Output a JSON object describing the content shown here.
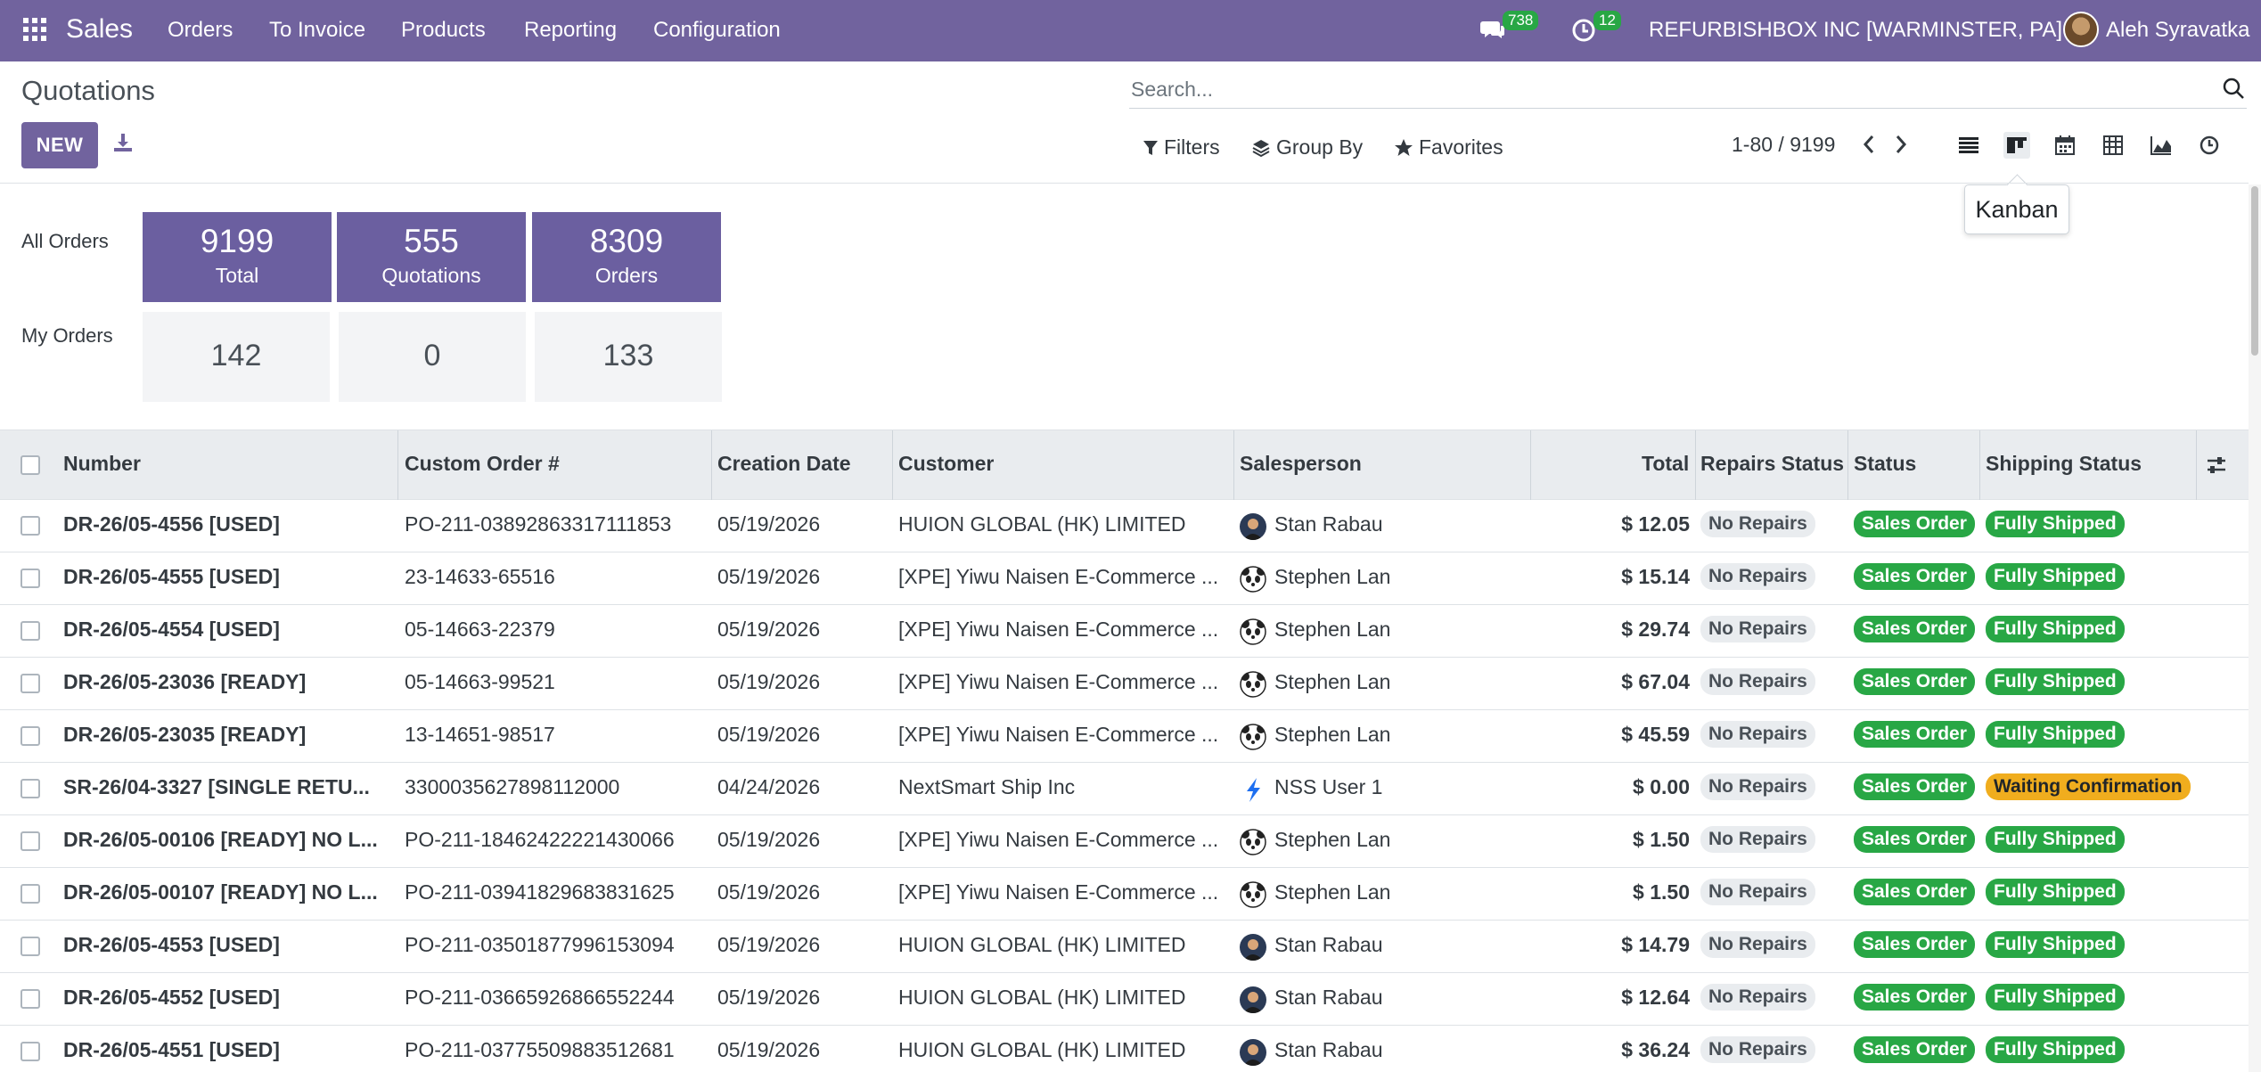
{
  "navbar": {
    "app_name": "Sales",
    "menu": [
      "Orders",
      "To Invoice",
      "Products",
      "Reporting",
      "Configuration"
    ],
    "messages_count": "738",
    "activities_count": "12",
    "company": "REFURBISHBOX INC [WARMINSTER, PA]",
    "user_name": "Aleh Syravatka",
    "bg_color": "#71639e"
  },
  "control_panel": {
    "title": "Quotations",
    "new_label": "NEW",
    "search_placeholder": "Search...",
    "filters_label": "Filters",
    "group_by_label": "Group By",
    "favorites_label": "Favorites",
    "pager_text": "1-80 / 9199",
    "views": [
      "list-icon",
      "kanban-icon",
      "calendar-icon",
      "pivot-icon",
      "graph-icon",
      "activity-icon"
    ],
    "tooltip": "Kanban"
  },
  "dashboard": {
    "all_orders_label": "All Orders",
    "my_orders_label": "My Orders",
    "all": [
      {
        "value": "9199",
        "label": "Total"
      },
      {
        "value": "555",
        "label": "Quotations"
      },
      {
        "value": "8309",
        "label": "Orders"
      }
    ],
    "my": [
      "142",
      "0",
      "133"
    ],
    "accent": "#6b5fa0"
  },
  "table": {
    "headers": [
      "Number",
      "Custom Order #",
      "Creation Date",
      "Customer",
      "Salesperson",
      "Total",
      "Repairs Status",
      "Status",
      "Shipping Status"
    ],
    "rows": [
      {
        "number": "DR-26/05-4556 [USED]",
        "custom": "PO-211-03892863317111853",
        "date": "05/19/2026",
        "customer": "HUION GLOBAL (HK) LIMITED",
        "salesperson": "Stan Rabau",
        "avatar": "photo",
        "total": "$ 12.05",
        "repairs": "No Repairs",
        "status": "Sales Order",
        "shipping": "Fully Shipped",
        "shipping_color": "green"
      },
      {
        "number": "DR-26/05-4555 [USED]",
        "custom": "23-14633-65516",
        "date": "05/19/2026",
        "customer": "[XPE] Yiwu Naisen E-Commerce ...",
        "salesperson": "Stephen Lan",
        "avatar": "panda",
        "total": "$ 15.14",
        "repairs": "No Repairs",
        "status": "Sales Order",
        "shipping": "Fully Shipped",
        "shipping_color": "green"
      },
      {
        "number": "DR-26/05-4554 [USED]",
        "custom": "05-14663-22379",
        "date": "05/19/2026",
        "customer": "[XPE] Yiwu Naisen E-Commerce ...",
        "salesperson": "Stephen Lan",
        "avatar": "panda",
        "total": "$ 29.74",
        "repairs": "No Repairs",
        "status": "Sales Order",
        "shipping": "Fully Shipped",
        "shipping_color": "green"
      },
      {
        "number": "DR-26/05-23036 [READY]",
        "custom": "05-14663-99521",
        "date": "05/19/2026",
        "customer": "[XPE] Yiwu Naisen E-Commerce ...",
        "salesperson": "Stephen Lan",
        "avatar": "panda",
        "total": "$ 67.04",
        "repairs": "No Repairs",
        "status": "Sales Order",
        "shipping": "Fully Shipped",
        "shipping_color": "green"
      },
      {
        "number": "DR-26/05-23035 [READY]",
        "custom": "13-14651-98517",
        "date": "05/19/2026",
        "customer": "[XPE] Yiwu Naisen E-Commerce ...",
        "salesperson": "Stephen Lan",
        "avatar": "panda",
        "total": "$ 45.59",
        "repairs": "No Repairs",
        "status": "Sales Order",
        "shipping": "Fully Shipped",
        "shipping_color": "green"
      },
      {
        "number": "SR-26/04-3327 [SINGLE RETU...",
        "custom": "3300035627898112000",
        "date": "04/24/2026",
        "customer": "NextSmart Ship Inc",
        "salesperson": "NSS User 1",
        "avatar": "bolt",
        "total": "$ 0.00",
        "repairs": "No Repairs",
        "status": "Sales Order",
        "shipping": "Waiting Confirmation",
        "shipping_color": "orange"
      },
      {
        "number": "DR-26/05-00106 [READY] NO L...",
        "custom": "PO-211-18462422221430066",
        "date": "05/19/2026",
        "customer": "[XPE] Yiwu Naisen E-Commerce ...",
        "salesperson": "Stephen Lan",
        "avatar": "panda",
        "total": "$ 1.50",
        "repairs": "No Repairs",
        "status": "Sales Order",
        "shipping": "Fully Shipped",
        "shipping_color": "green"
      },
      {
        "number": "DR-26/05-00107 [READY] NO L...",
        "custom": "PO-211-03941829683831625",
        "date": "05/19/2026",
        "customer": "[XPE] Yiwu Naisen E-Commerce ...",
        "salesperson": "Stephen Lan",
        "avatar": "panda",
        "total": "$ 1.50",
        "repairs": "No Repairs",
        "status": "Sales Order",
        "shipping": "Fully Shipped",
        "shipping_color": "green"
      },
      {
        "number": "DR-26/05-4553 [USED]",
        "custom": "PO-211-03501877996153094",
        "date": "05/19/2026",
        "customer": "HUION GLOBAL (HK) LIMITED",
        "salesperson": "Stan Rabau",
        "avatar": "photo",
        "total": "$ 14.79",
        "repairs": "No Repairs",
        "status": "Sales Order",
        "shipping": "Fully Shipped",
        "shipping_color": "green"
      },
      {
        "number": "DR-26/05-4552 [USED]",
        "custom": "PO-211-03665926866552244",
        "date": "05/19/2026",
        "customer": "HUION GLOBAL (HK) LIMITED",
        "salesperson": "Stan Rabau",
        "avatar": "photo",
        "total": "$ 12.64",
        "repairs": "No Repairs",
        "status": "Sales Order",
        "shipping": "Fully Shipped",
        "shipping_color": "green"
      },
      {
        "number": "DR-26/05-4551 [USED]",
        "custom": "PO-211-03775509883512681",
        "date": "05/19/2026",
        "customer": "HUION GLOBAL (HK) LIMITED",
        "salesperson": "Stan Rabau",
        "avatar": "photo",
        "total": "$ 36.24",
        "repairs": "No Repairs",
        "status": "Sales Order",
        "shipping": "Fully Shipped",
        "shipping_color": "green"
      }
    ]
  }
}
